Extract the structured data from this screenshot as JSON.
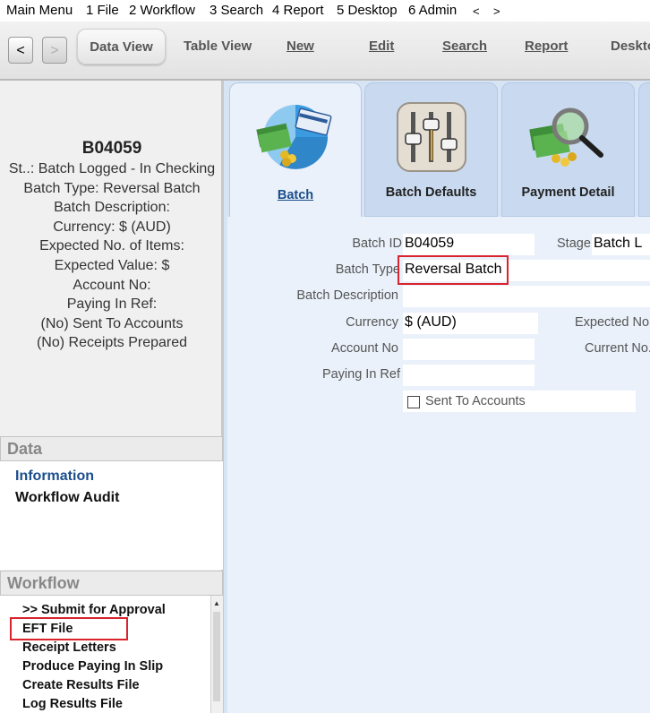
{
  "menu": {
    "items": [
      "Main Menu",
      "1 File",
      "2 Workflow",
      "3 Search",
      "4 Report",
      "5 Desktop",
      "6 Admin",
      "<",
      ">"
    ]
  },
  "toolbar": {
    "back_label": "<",
    "forward_label": ">",
    "buttons": [
      "Data View",
      "Table View",
      "New",
      "Edit",
      "Search",
      "Report",
      "Deskto"
    ]
  },
  "summary": {
    "batch_id": "B04059",
    "lines": [
      "St..: Batch Logged - In Checking",
      "Batch Type: Reversal Batch",
      "Batch Description:",
      "Currency: $ (AUD)",
      "Expected No. of Items:",
      "Expected Value: $",
      "Account No:",
      "Paying In Ref:",
      "(No) Sent To Accounts",
      "(No) Receipts Prepared"
    ]
  },
  "data_section": {
    "title": "Data",
    "links": [
      "Information",
      "Workflow Audit"
    ]
  },
  "workflow_section": {
    "title": "Workflow",
    "items": [
      ">> Submit for Approval",
      "EFT File",
      "Receipt Letters",
      "Produce Paying In Slip",
      "Create Results File",
      "Log Results File"
    ]
  },
  "tabs": [
    "Batch",
    "Batch Defaults",
    "Payment Detail"
  ],
  "form": {
    "batch_id_label": "Batch ID",
    "batch_id_value": "B04059",
    "stage_label": "Stage",
    "stage_value": "Batch L",
    "batch_type_label": "Batch Type",
    "batch_type_value": "Reversal Batch",
    "batch_description_label": "Batch Description",
    "batch_description_value": "",
    "currency_label": "Currency",
    "currency_value": "$ (AUD)",
    "expected_no_label": "Expected No.",
    "account_no_label": "Account No",
    "account_no_value": "",
    "current_no_label": "Current No.",
    "paying_in_ref_label": "Paying In Ref",
    "paying_in_ref_value": "",
    "sent_to_accounts_label": "Sent To Accounts"
  },
  "colors": {
    "highlight": "#d9232d",
    "link": "#1b4e8c",
    "main_bg": "#d6e4f4"
  }
}
